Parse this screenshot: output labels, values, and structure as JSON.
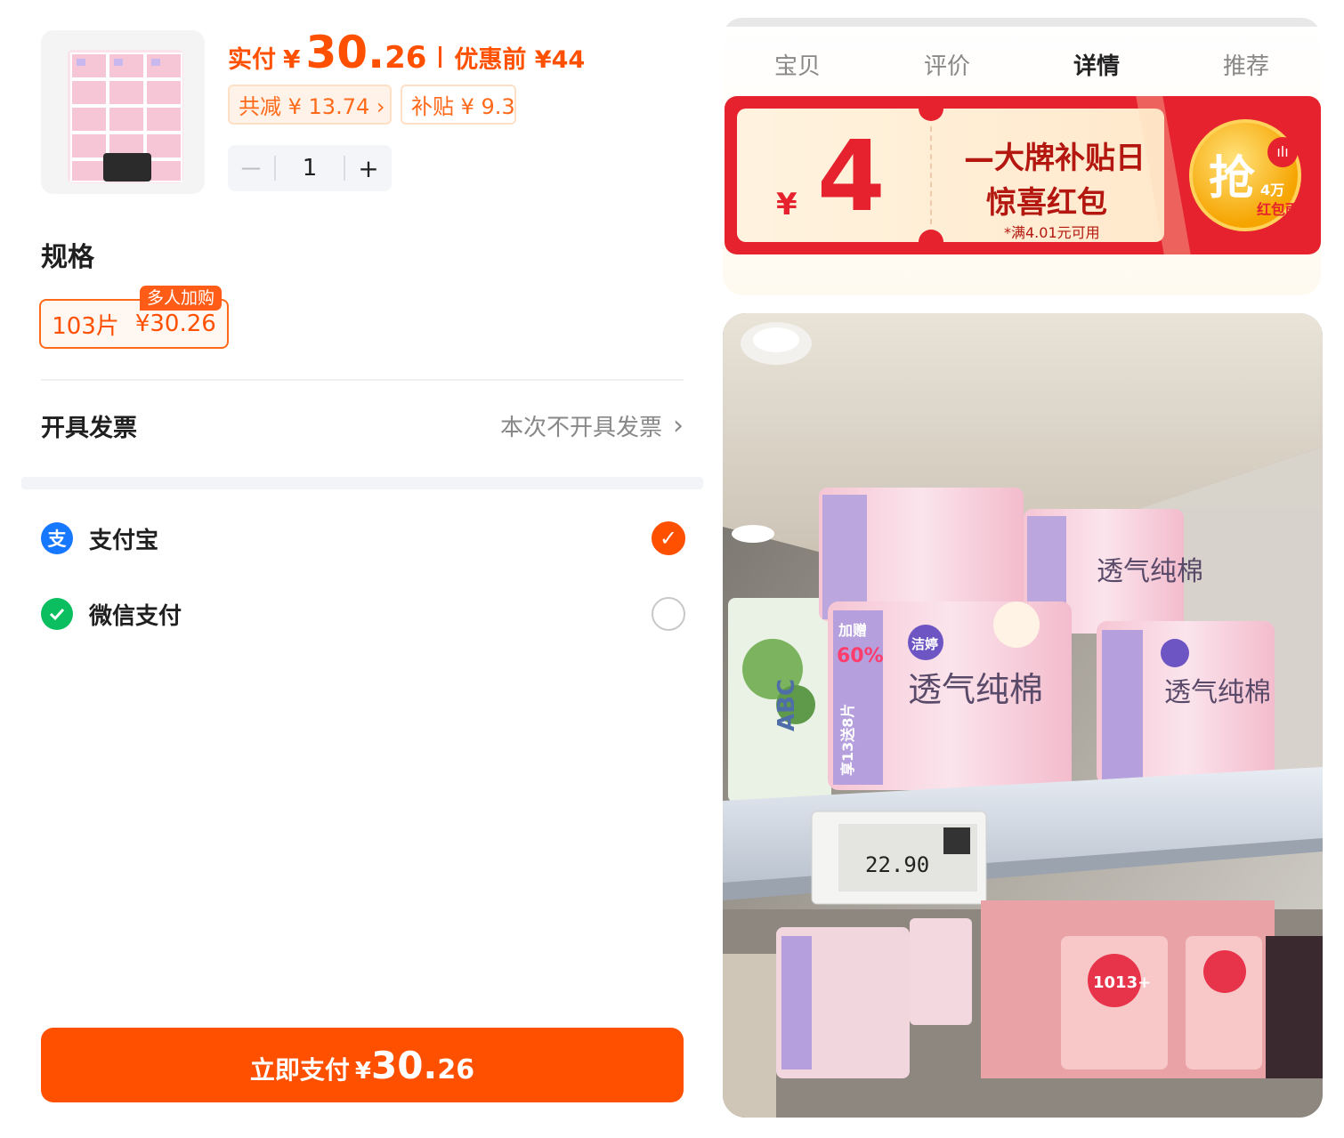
{
  "checkout": {
    "price_label": "实付",
    "currency": "¥",
    "price_int": "30.",
    "price_dec": "26",
    "orig_label": "优惠前 ¥44",
    "discount_tag": "共减 ¥ 13.74 ›",
    "subsidy_tag": "补贴 ¥ 9.3",
    "quantity": "1",
    "minus": "－",
    "plus": "+",
    "spec_title": "规格",
    "spec_badge": "多人加购",
    "spec_qty": "103片",
    "spec_price": "¥30.26",
    "invoice_label": "开具发票",
    "invoice_value": "本次不开具发票",
    "payment_methods": [
      {
        "name": "支付宝",
        "icon": "alipay-icon",
        "selected": true
      },
      {
        "name": "微信支付",
        "icon": "wechat-pay-icon",
        "selected": false
      }
    ],
    "pay_button_label": "立即支付",
    "pay_button_yen": "¥",
    "pay_button_int": "30.",
    "pay_button_dec": "26"
  },
  "detail": {
    "tabs": [
      "宝贝",
      "评价",
      "详情",
      "推荐"
    ],
    "active_tab": "详情",
    "coupon": {
      "currency": "¥",
      "amount": "4",
      "title1": "—大牌补贴日",
      "title2": "惊喜红包",
      "note": "*满4.01元可用",
      "grab": "抢",
      "grab_sub1": "4万",
      "grab_sub2": "红包雨"
    },
    "photo": {
      "brand": "洁婷",
      "product_name": "透气纯棉",
      "promo_top": "加赠",
      "promo_pct": "60%",
      "promo_side": "享13送8片",
      "shelf_price": "22.90",
      "side_brand": "ABC",
      "small_product": "1013+"
    }
  },
  "colors": {
    "accent": "#ff5000",
    "coupon_red": "#e5222d",
    "alipay": "#1677ff",
    "wechat": "#0bbf60"
  }
}
